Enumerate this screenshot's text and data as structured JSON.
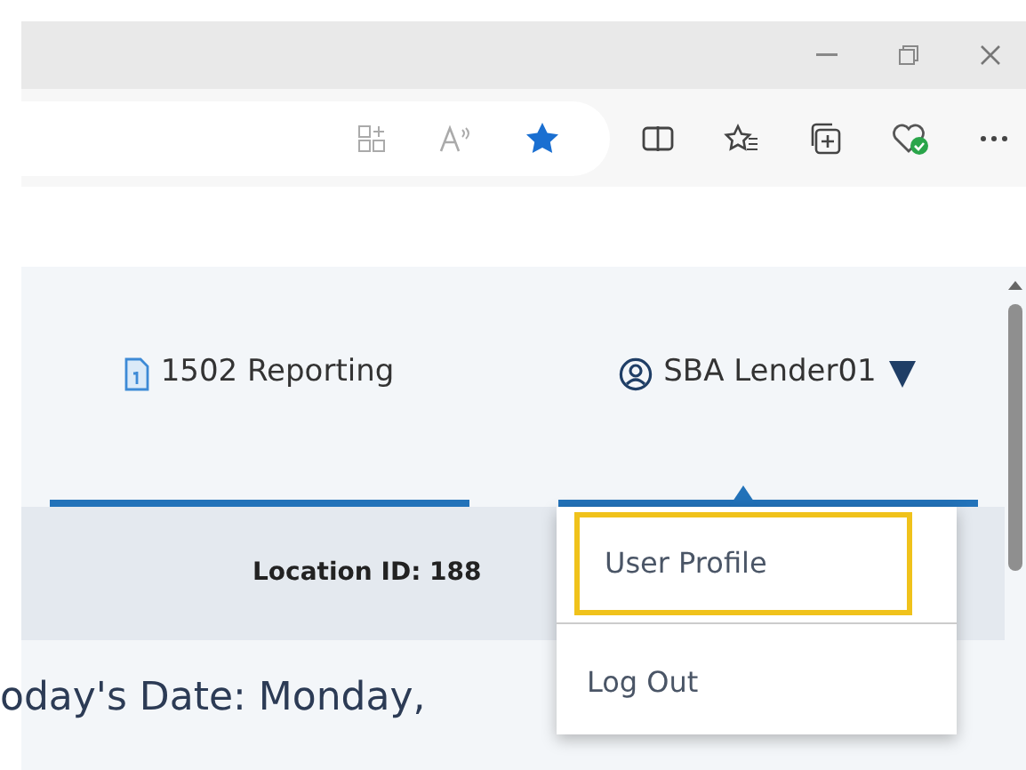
{
  "nav": [
    {
      "label": "1502 Reporting",
      "kind": "report"
    },
    {
      "label": "SBA Lender01",
      "kind": "user",
      "expanded": true
    }
  ],
  "location": {
    "label": "Location ID: 188"
  },
  "dropdown": [
    {
      "label": "User Profile",
      "focused": true
    },
    {
      "label": "Log Out",
      "focused": false
    }
  ],
  "date": {
    "text": "oday's Date: Monday,"
  }
}
